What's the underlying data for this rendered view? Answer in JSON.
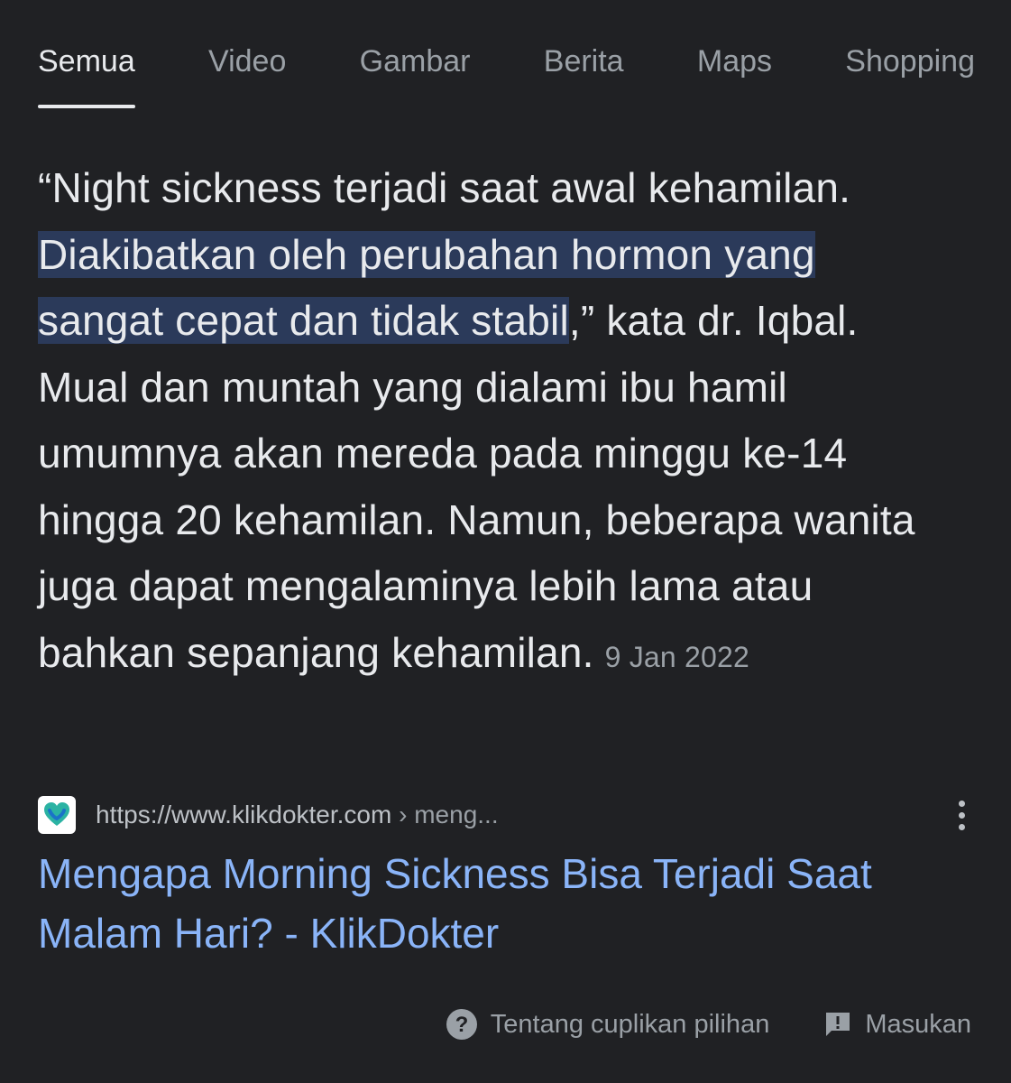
{
  "tabs": [
    {
      "label": "Semua",
      "active": true
    },
    {
      "label": "Video",
      "active": false
    },
    {
      "label": "Gambar",
      "active": false
    },
    {
      "label": "Berita",
      "active": false
    },
    {
      "label": "Maps",
      "active": false
    },
    {
      "label": "Shopping",
      "active": false
    }
  ],
  "snippet": {
    "text_before": "“Night sickness terjadi saat awal kehamilan. ",
    "highlighted": "Diakibatkan oleh perubahan hormon yang sangat cepat dan tidak stabil",
    "text_after": ",” kata dr. Iqbal. Mual dan muntah yang dialami ibu hamil umumnya akan mereda pada minggu ke-14 hingga 20 kehamilan. Namun, beberapa wanita juga dapat mengalaminya lebih lama atau bahkan sepanjang kehamilan.",
    "date": "9 Jan 2022"
  },
  "source": {
    "url": "https://www.klikdokter.com",
    "breadcrumb": " › meng...",
    "favicon": "klikdokter-heart-icon"
  },
  "result": {
    "title": "Mengapa Morning Sickness Bisa Terjadi Saat Malam Hari? - KlikDokter"
  },
  "footer": {
    "about_label": "Tentang cuplikan pilihan",
    "feedback_label": "Masukan"
  },
  "colors": {
    "background": "#202124",
    "text": "#e8eaed",
    "muted": "#9aa0a6",
    "link": "#8ab4f8",
    "highlight": "#2b3a5a"
  }
}
